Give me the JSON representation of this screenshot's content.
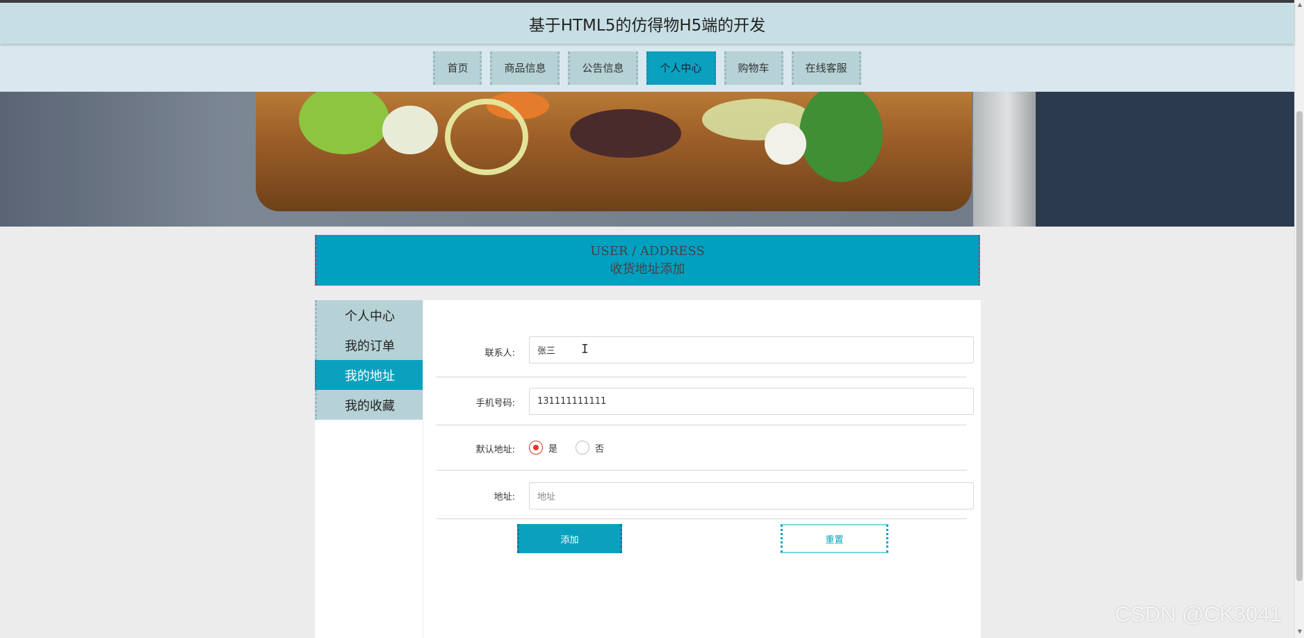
{
  "header": {
    "title": "基于HTML5的仿得物H5端的开发"
  },
  "nav": {
    "items": [
      {
        "label": "首页",
        "active": false
      },
      {
        "label": "商品信息",
        "active": false
      },
      {
        "label": "公告信息",
        "active": false
      },
      {
        "label": "个人中心",
        "active": true
      },
      {
        "label": "购物车",
        "active": false
      },
      {
        "label": "在线客服",
        "active": false
      }
    ]
  },
  "section": {
    "title_en": "USER / ADDRESS",
    "title_cn": "收货地址添加"
  },
  "sidebar": {
    "items": [
      {
        "label": "个人中心",
        "active": false
      },
      {
        "label": "我的订单",
        "active": false
      },
      {
        "label": "我的地址",
        "active": true
      },
      {
        "label": "我的收藏",
        "active": false
      }
    ]
  },
  "form": {
    "contact": {
      "label": "联系人:",
      "value": "张三"
    },
    "phone": {
      "label": "手机号码:",
      "value": "131111111111"
    },
    "default_address": {
      "label": "默认地址:",
      "options": [
        {
          "label": "是",
          "checked": true
        },
        {
          "label": "否",
          "checked": false
        }
      ]
    },
    "address": {
      "label": "地址:",
      "placeholder": "地址"
    }
  },
  "buttons": {
    "add": "添加",
    "reset": "重置"
  },
  "watermark": "CSDN @CK3041",
  "colors": {
    "accent": "#0aa1bf",
    "header_bg": "#c7dfe4",
    "radio_checked": "#e0361f"
  }
}
